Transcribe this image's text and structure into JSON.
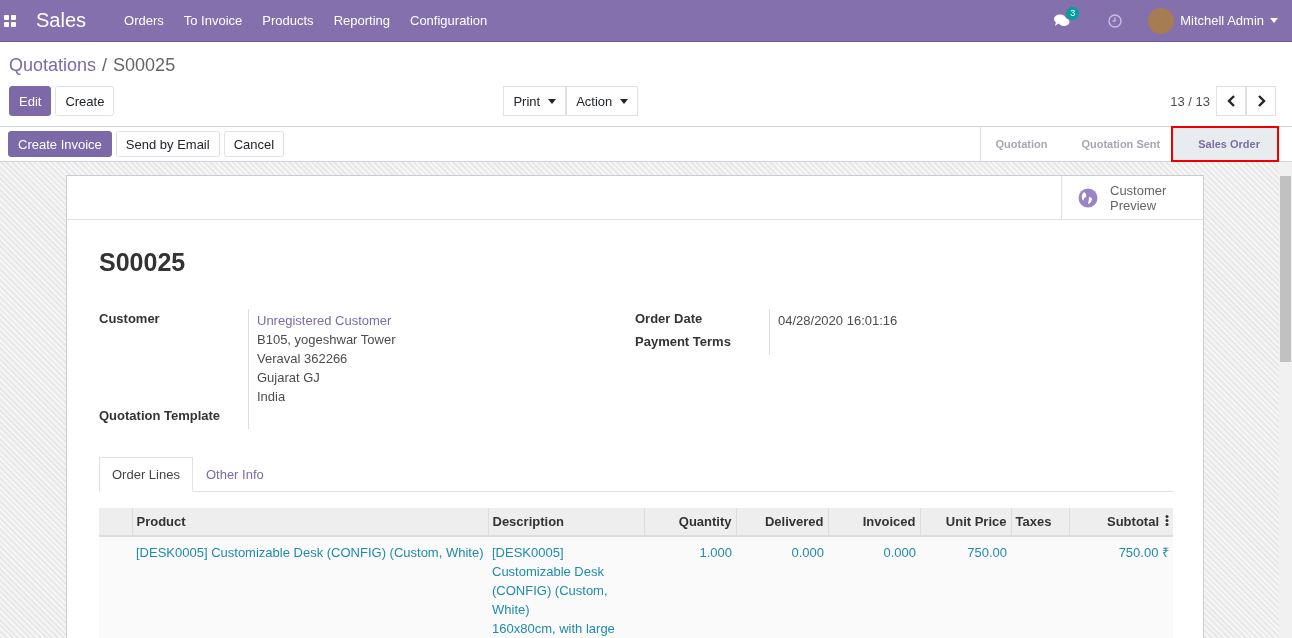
{
  "navbar": {
    "app_title": "Sales",
    "menu": [
      "Orders",
      "To Invoice",
      "Products",
      "Reporting",
      "Configuration"
    ],
    "messages_badge": "3",
    "user": "Mitchell Admin"
  },
  "breadcrumb": {
    "parent": "Quotations",
    "separator": "/",
    "current": "S00025"
  },
  "actions": {
    "main": [
      "Edit",
      "Create"
    ],
    "dropdowns": [
      "Print",
      "Action"
    ],
    "pager": "13 / 13"
  },
  "header_buttons": [
    {
      "label": "Create Invoice",
      "primary": true
    },
    {
      "label": "Send by Email",
      "primary": false
    },
    {
      "label": "Cancel",
      "primary": false
    }
  ],
  "status_steps": [
    {
      "label": "Quotation",
      "selected": false,
      "highlighted": false
    },
    {
      "label": "Quotation Sent",
      "selected": false,
      "highlighted": false
    },
    {
      "label": "Sales Order",
      "selected": true,
      "highlighted": true
    }
  ],
  "smart_button": {
    "label": "Customer\nPreview"
  },
  "title": "S00025",
  "left_fields": [
    {
      "label": "Customer",
      "link": "Unregistered Customer",
      "lines": [
        "B105, yogeshwar Tower",
        "Veraval 362266",
        "Gujarat GJ",
        "India"
      ]
    },
    {
      "label": "Quotation Template"
    }
  ],
  "right_fields": [
    {
      "label": "Order Date",
      "value": "04/28/2020 16:01:16"
    },
    {
      "label": "Payment Terms"
    }
  ],
  "tabs": [
    {
      "label": "Order Lines",
      "selected": true
    },
    {
      "label": "Other Info",
      "selected": false
    }
  ],
  "table": {
    "columns": [
      "Product",
      "Description",
      "Quantity",
      "Delivered",
      "Invoiced",
      "Unit Price",
      "Taxes",
      "Subtotal"
    ],
    "rows": [
      {
        "product": "[DESK0005] Customizable Desk (CONFIG) (Custom, White)",
        "description": [
          "[DESK0005]",
          "Customizable Desk",
          "(CONFIG) (Custom,",
          "White)",
          "160x80cm, with large"
        ],
        "quantity": "1.000",
        "delivered": "0.000",
        "invoiced": "0.000",
        "unit_price": "750.00",
        "subtotal": "750.00 ₹"
      }
    ]
  }
}
